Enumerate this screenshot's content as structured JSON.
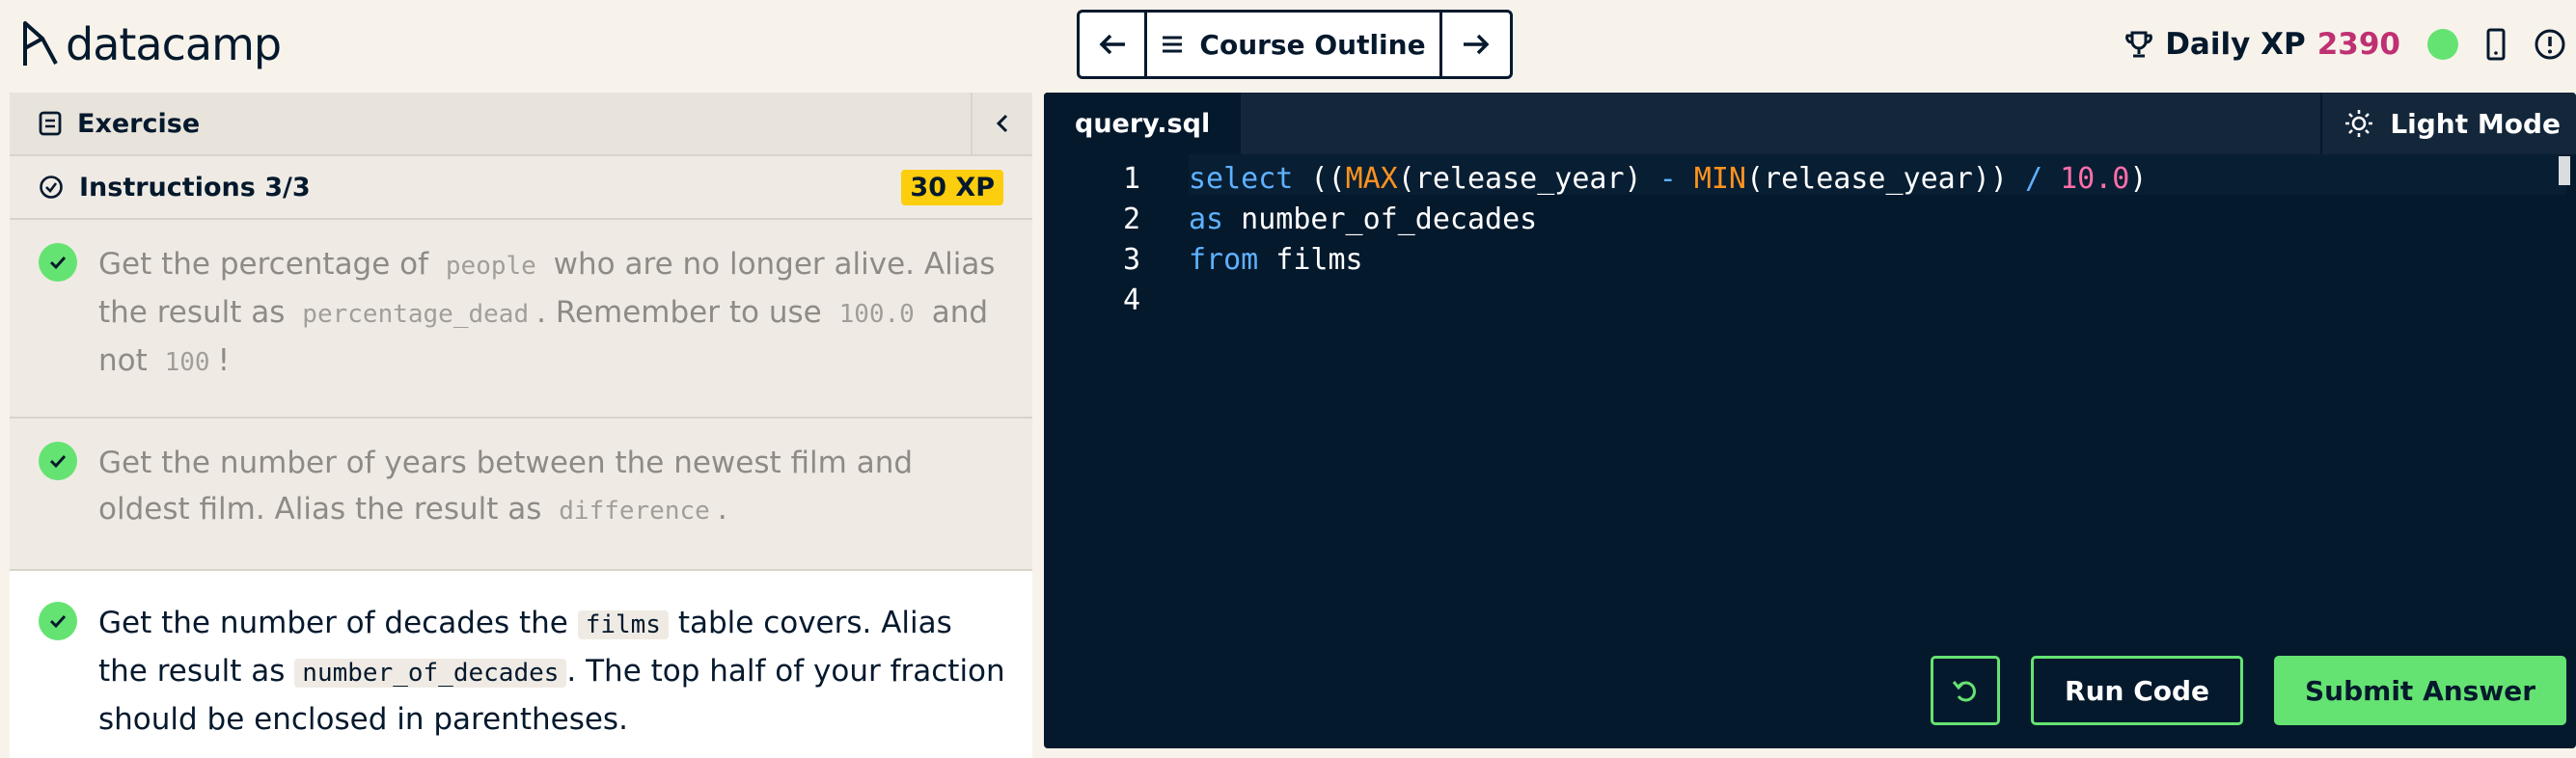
{
  "brand": {
    "name": "datacamp"
  },
  "nav": {
    "outline_label": "Course Outline"
  },
  "user": {
    "xp_label": "Daily XP",
    "xp_value": "2390"
  },
  "exercise": {
    "header_label": "Exercise",
    "instructions_label": "Instructions 3/3",
    "xp_badge": "30 XP",
    "steps": [
      {
        "pre": "Get the percentage of ",
        "code1": "people",
        "mid1": " who are no longer alive. Alias the result as ",
        "code2": "percentage_dead",
        "mid2": ". Remember to use ",
        "code3": "100.0",
        "mid3": " and not ",
        "code4": "100",
        "post": "!"
      },
      {
        "pre": "Get the number of years between the newest film and oldest film. Alias the result as ",
        "code1": "difference",
        "post": "."
      },
      {
        "pre": "Get the number of decades the ",
        "code1": "films",
        "mid1": " table covers. Alias the result as ",
        "code2": "number_of_decades",
        "post": ". The top half of your fraction should be enclosed in parentheses."
      }
    ]
  },
  "editor": {
    "tab_name": "query.sql",
    "theme_toggle_label": "Light Mode",
    "line_numbers": [
      "1",
      "2",
      "3",
      "4"
    ],
    "code": {
      "l1_kw": "select",
      "l1_a": " ((",
      "l1_fn1": "MAX",
      "l1_b": "(release_year) ",
      "l1_op1": "-",
      "l1_c": " ",
      "l1_fn2": "MIN",
      "l1_d": "(release_year)) ",
      "l1_op2": "/",
      "l1_e": " ",
      "l1_num": "10.0",
      "l1_f": ")",
      "l2_kw": "as",
      "l2_rest": " number_of_decades",
      "l3_kw": "from",
      "l3_rest": " films"
    },
    "run_label": "Run Code",
    "submit_label": "Submit Answer"
  },
  "colors": {
    "accent_green": "#65e372",
    "xp_pink": "#bf3072",
    "badge_yellow": "#fcce0d",
    "editor_bg": "#05192d"
  }
}
